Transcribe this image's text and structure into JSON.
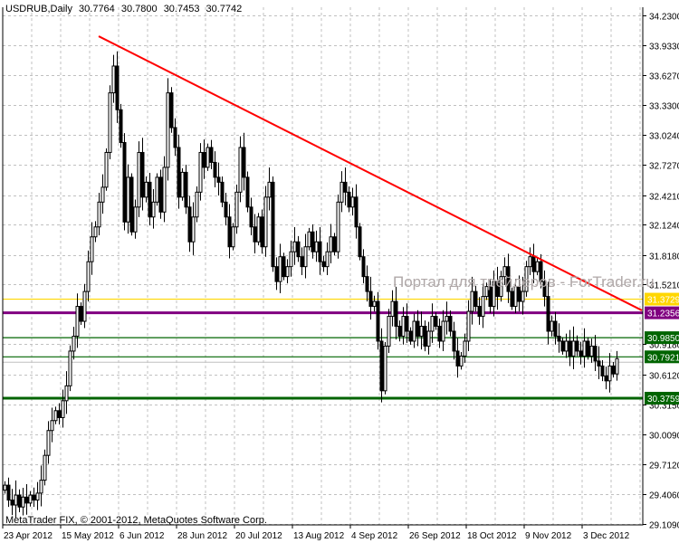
{
  "header": {
    "symbol": "USDRUB,Daily",
    "open": "30.7764",
    "high": "30.7800",
    "low": "30.7453",
    "close": "30.7742"
  },
  "watermark": "Портал для трейдеров - ForTrader.ru",
  "copyright": "MetaTrader FIX, © 2001-2012, MetaQuotes Software Corp.",
  "colors": {
    "up_body": "#ffffff",
    "down_body": "#000000",
    "trendline": "#ff0000",
    "grid": "#c0c0c0"
  },
  "chart_data": {
    "type": "candlestick",
    "title": "USDRUB,Daily",
    "ylim": [
      29.109,
      34.23
    ],
    "y_ticks": [
      "34.2300",
      "33.9330",
      "33.6270",
      "33.3300",
      "33.0240",
      "32.7270",
      "32.4210",
      "32.1240",
      "31.8180",
      "31.5210",
      "30.9180",
      "30.6120",
      "30.3150",
      "30.0090",
      "29.7120",
      "29.4060",
      "29.1090"
    ],
    "x_labels": [
      {
        "bar": 0,
        "label": "23 Apr 2012"
      },
      {
        "bar": 16,
        "label": "15 May 2012"
      },
      {
        "bar": 32,
        "label": "6 Jun 2012"
      },
      {
        "bar": 48,
        "label": "28 Jun 2012"
      },
      {
        "bar": 64,
        "label": "20 Jul 2012"
      },
      {
        "bar": 80,
        "label": "13 Aug 2012"
      },
      {
        "bar": 96,
        "label": "4 Sep 2012"
      },
      {
        "bar": 112,
        "label": "26 Sep 2012"
      },
      {
        "bar": 128,
        "label": "18 Oct 2012"
      },
      {
        "bar": 144,
        "label": "9 Nov 2012"
      },
      {
        "bar": 160,
        "label": "3 Dec 2012"
      }
    ],
    "first_open": 29.45,
    "closes": [
      29.5,
      29.35,
      29.3,
      29.4,
      29.28,
      29.38,
      29.32,
      29.4,
      29.35,
      29.42,
      29.55,
      29.8,
      30.05,
      30.15,
      30.25,
      30.18,
      30.35,
      30.5,
      30.85,
      31.0,
      31.3,
      31.15,
      31.45,
      31.75,
      32.0,
      32.1,
      32.35,
      32.5,
      32.85,
      33.45,
      33.72,
      33.28,
      32.95,
      32.15,
      32.6,
      32.05,
      32.3,
      32.85,
      32.4,
      32.55,
      32.2,
      32.35,
      32.6,
      32.25,
      32.7,
      33.45,
      33.1,
      32.9,
      32.4,
      32.65,
      32.3,
      31.95,
      32.2,
      32.45,
      32.85,
      32.7,
      32.9,
      32.75,
      32.6,
      32.55,
      32.35,
      32.2,
      31.9,
      32.1,
      32.45,
      32.9,
      32.6,
      32.3,
      32.1,
      31.95,
      32.2,
      31.9,
      32.4,
      32.55,
      31.7,
      31.55,
      31.8,
      31.6,
      31.7,
      31.85,
      31.95,
      31.8,
      31.7,
      31.9,
      32.05,
      31.85,
      31.95,
      31.75,
      31.7,
      31.85,
      32.0,
      31.85,
      32.35,
      32.55,
      32.45,
      32.3,
      32.4,
      32.1,
      31.8,
      31.6,
      31.45,
      31.3,
      31.35,
      30.95,
      30.45,
      30.9,
      31.2,
      31.35,
      31.1,
      31.0,
      31.2,
      31.05,
      30.95,
      31.15,
      31.0,
      31.1,
      30.9,
      31.05,
      31.2,
      31.1,
      30.95,
      31.15,
      31.2,
      31.05,
      30.85,
      30.7,
      30.8,
      30.95,
      31.25,
      31.45,
      31.3,
      31.2,
      31.4,
      31.5,
      31.3,
      31.55,
      31.4,
      31.6,
      31.7,
      31.45,
      31.3,
      31.5,
      31.35,
      31.45,
      31.7,
      31.8,
      31.65,
      31.75,
      31.55,
      31.4,
      31.05,
      31.15,
      31.0,
      30.95,
      30.85,
      30.95,
      30.8,
      30.95,
      30.85,
      30.8,
      30.95,
      30.8,
      30.9,
      30.75,
      30.7,
      30.6,
      30.55,
      30.7,
      30.62,
      30.7742
    ],
    "trendline": {
      "from": {
        "bar": 26,
        "price": 34.02
      },
      "to": {
        "bar": 176,
        "price": 31.26
      }
    },
    "levels": [
      {
        "price": 31.3729,
        "label": "31.3729",
        "color": "#ffd700",
        "text_color": "#ffffff",
        "thick": false
      },
      {
        "price": 31.2356,
        "label": "31.2356",
        "color": "#800080",
        "text_color": "#ffffff",
        "thick": true
      },
      {
        "price": 30.985,
        "label": "30.9850",
        "color": "#006400",
        "text_color": "#ffffff",
        "thick": false
      },
      {
        "price": 30.7921,
        "label": "30.7921",
        "color": "#006400",
        "text_color": "#ffffff",
        "thick": false
      },
      {
        "price": 30.3759,
        "label": "30.3759",
        "color": "#006400",
        "text_color": "#ffffff",
        "thick": true
      }
    ]
  }
}
